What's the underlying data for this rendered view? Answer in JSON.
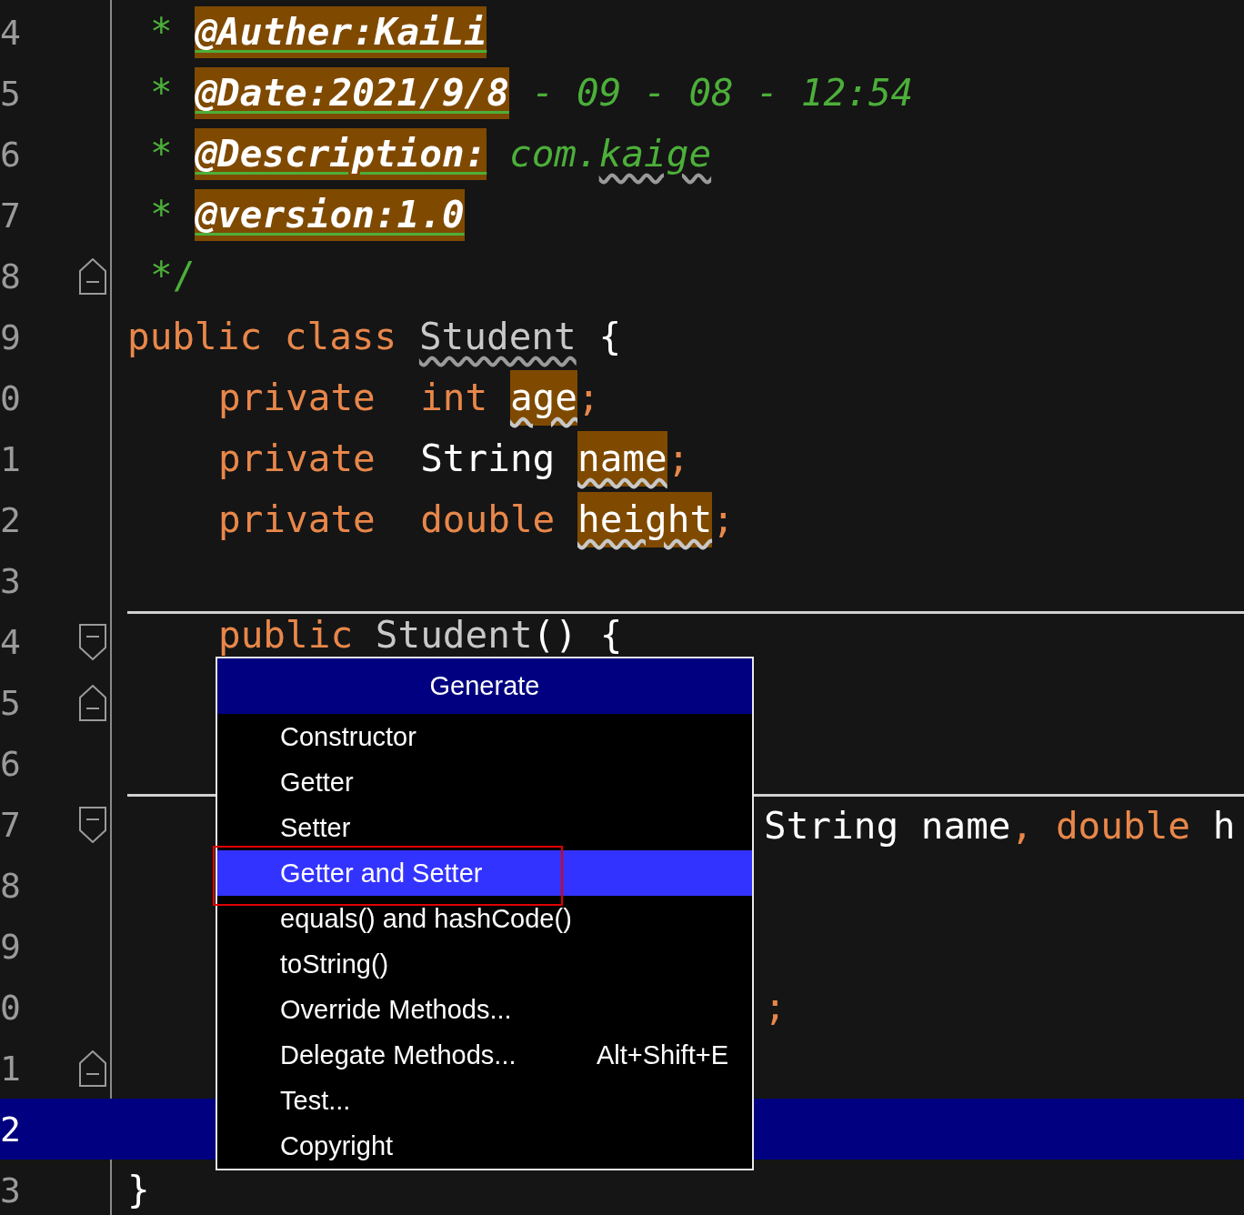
{
  "editor": {
    "lines": [
      {
        "number": "4",
        "kind": "comment",
        "fold_start": false,
        "fold_end": false,
        "separator_above": false,
        "current": false,
        "tokens": [
          {
            "text": "* ",
            "kind": "comment-mark"
          },
          {
            "text": "@Auther:KaiLi",
            "kind": "tag"
          }
        ]
      },
      {
        "number": "5",
        "kind": "comment",
        "fold_start": false,
        "fold_end": false,
        "separator_above": false,
        "current": false,
        "tokens": [
          {
            "text": "* ",
            "kind": "comment-mark"
          },
          {
            "text": "@Date:2021/9/8",
            "kind": "tag"
          },
          {
            "text": " - 09 - 08 - 12:54",
            "kind": "comment-text"
          }
        ]
      },
      {
        "number": "6",
        "kind": "comment",
        "fold_start": false,
        "fold_end": false,
        "separator_above": false,
        "current": false,
        "tokens": [
          {
            "text": "* ",
            "kind": "comment-mark"
          },
          {
            "text": "@Description:",
            "kind": "tag"
          },
          {
            "text": " com.",
            "kind": "comment-text"
          },
          {
            "text": "kaige",
            "kind": "comment-warn"
          }
        ]
      },
      {
        "number": "7",
        "kind": "comment",
        "fold_start": false,
        "fold_end": false,
        "separator_above": false,
        "current": false,
        "tokens": [
          {
            "text": "* ",
            "kind": "comment-mark"
          },
          {
            "text": "@version:1.0",
            "kind": "tag"
          }
        ]
      },
      {
        "number": "8",
        "kind": "comment",
        "fold_start": false,
        "fold_end": true,
        "separator_above": false,
        "current": false,
        "tokens": [
          {
            "text": "*/",
            "kind": "comment-mark"
          }
        ]
      },
      {
        "number": "9",
        "kind": "top",
        "fold_start": false,
        "fold_end": false,
        "separator_above": false,
        "current": false,
        "tokens": [
          {
            "text": "public class ",
            "kind": "keyword"
          },
          {
            "text": "Student",
            "kind": "class-name"
          },
          {
            "text": " {",
            "kind": "plain"
          }
        ]
      },
      {
        "number": "0",
        "kind": "member",
        "fold_start": false,
        "fold_end": false,
        "separator_above": false,
        "current": false,
        "tokens": [
          {
            "text": "private  ",
            "kind": "keyword"
          },
          {
            "text": "int ",
            "kind": "keyword"
          },
          {
            "text": "age",
            "kind": "field"
          },
          {
            "text": ";",
            "kind": "punct"
          }
        ]
      },
      {
        "number": "1",
        "kind": "member",
        "fold_start": false,
        "fold_end": false,
        "separator_above": false,
        "current": false,
        "tokens": [
          {
            "text": "private  ",
            "kind": "keyword"
          },
          {
            "text": "String ",
            "kind": "plain"
          },
          {
            "text": "name",
            "kind": "field"
          },
          {
            "text": ";",
            "kind": "punct"
          }
        ]
      },
      {
        "number": "2",
        "kind": "member",
        "fold_start": false,
        "fold_end": false,
        "separator_above": false,
        "current": false,
        "tokens": [
          {
            "text": "private  ",
            "kind": "keyword"
          },
          {
            "text": "double ",
            "kind": "keyword"
          },
          {
            "text": "height",
            "kind": "field"
          },
          {
            "text": ";",
            "kind": "punct"
          }
        ]
      },
      {
        "number": "3",
        "kind": "member",
        "fold_start": false,
        "fold_end": false,
        "separator_above": false,
        "current": false
      },
      {
        "number": "4",
        "kind": "member",
        "fold_start": true,
        "fold_end": false,
        "separator_above": true,
        "current": false,
        "tokens": [
          {
            "text": "public ",
            "kind": "keyword"
          },
          {
            "text": "Student",
            "kind": "ctor"
          },
          {
            "text": "() {",
            "kind": "plain"
          }
        ]
      },
      {
        "number": "5",
        "kind": "member",
        "fold_start": false,
        "fold_end": true,
        "separator_above": false,
        "current": false
      },
      {
        "number": "6",
        "kind": "member",
        "fold_start": false,
        "fold_end": false,
        "separator_above": false,
        "current": false
      },
      {
        "number": "7",
        "kind": "behind-popup",
        "fold_start": true,
        "fold_end": false,
        "separator_above": true,
        "current": false,
        "tokens": [
          {
            "text": "String ",
            "kind": "plain"
          },
          {
            "text": "name",
            "kind": "plain"
          },
          {
            "text": ", ",
            "kind": "punct"
          },
          {
            "text": "double ",
            "kind": "keyword"
          },
          {
            "text": "h",
            "kind": "plain"
          }
        ]
      },
      {
        "number": "8",
        "kind": "member",
        "fold_start": false,
        "fold_end": false,
        "separator_above": false,
        "current": false
      },
      {
        "number": "9",
        "kind": "member",
        "fold_start": false,
        "fold_end": false,
        "separator_above": false,
        "current": false
      },
      {
        "number": "0",
        "kind": "behind-popup",
        "fold_start": false,
        "fold_end": false,
        "separator_above": false,
        "current": false,
        "tokens": [
          {
            "text": ";",
            "kind": "punct"
          }
        ]
      },
      {
        "number": "1",
        "kind": "member",
        "fold_start": false,
        "fold_end": true,
        "separator_above": false,
        "current": false
      },
      {
        "number": "2",
        "kind": "member",
        "fold_start": false,
        "fold_end": false,
        "separator_above": false,
        "current": true
      },
      {
        "number": "3",
        "kind": "top",
        "fold_start": false,
        "fold_end": false,
        "separator_above": false,
        "current": false,
        "tokens": [
          {
            "text": "}",
            "kind": "plain"
          }
        ]
      }
    ]
  },
  "popup": {
    "title": "Generate",
    "items": [
      {
        "label": "Constructor",
        "selected": false
      },
      {
        "label": "Getter",
        "selected": false
      },
      {
        "label": "Setter",
        "selected": false
      },
      {
        "label": "Getter and Setter",
        "selected": true
      },
      {
        "label": "equals() and hashCode()",
        "selected": false
      },
      {
        "label": "toString()",
        "selected": false
      },
      {
        "label": "Override Methods...",
        "selected": false
      },
      {
        "label": "Delegate Methods...",
        "shortcut": "Alt+Shift+E",
        "selected": false
      },
      {
        "label": "Test...",
        "selected": false
      },
      {
        "label": "Copyright",
        "selected": false
      }
    ]
  }
}
